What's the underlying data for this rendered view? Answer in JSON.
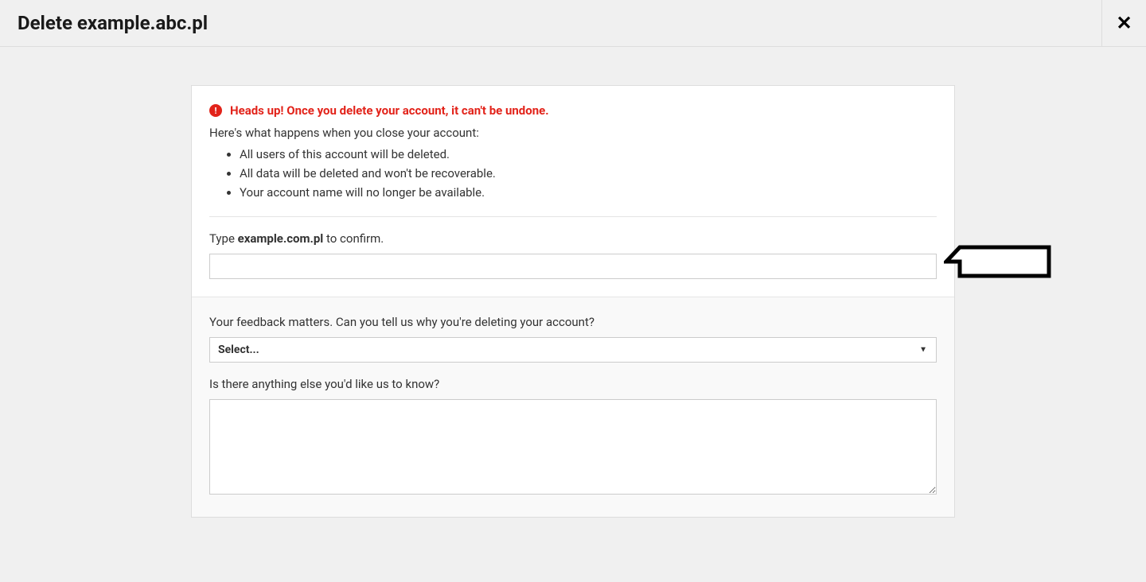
{
  "header": {
    "title": "Delete example.abc.pl"
  },
  "warning": {
    "text": "Heads up! Once you delete your account, it can't be undone."
  },
  "intro": "Here's what happens when you close your account:",
  "consequences": [
    "All users of this account will be deleted.",
    "All data will be deleted and won't be recoverable.",
    "Your account name will no longer be available."
  ],
  "confirm": {
    "prefix": "Type ",
    "domain": "example.com.pl",
    "suffix": " to confirm."
  },
  "feedback": {
    "reason_label": "Your feedback matters. Can you tell us why you're deleting your account?",
    "select_placeholder": "Select...",
    "extra_label": "Is there anything else you'd like us to know?"
  }
}
